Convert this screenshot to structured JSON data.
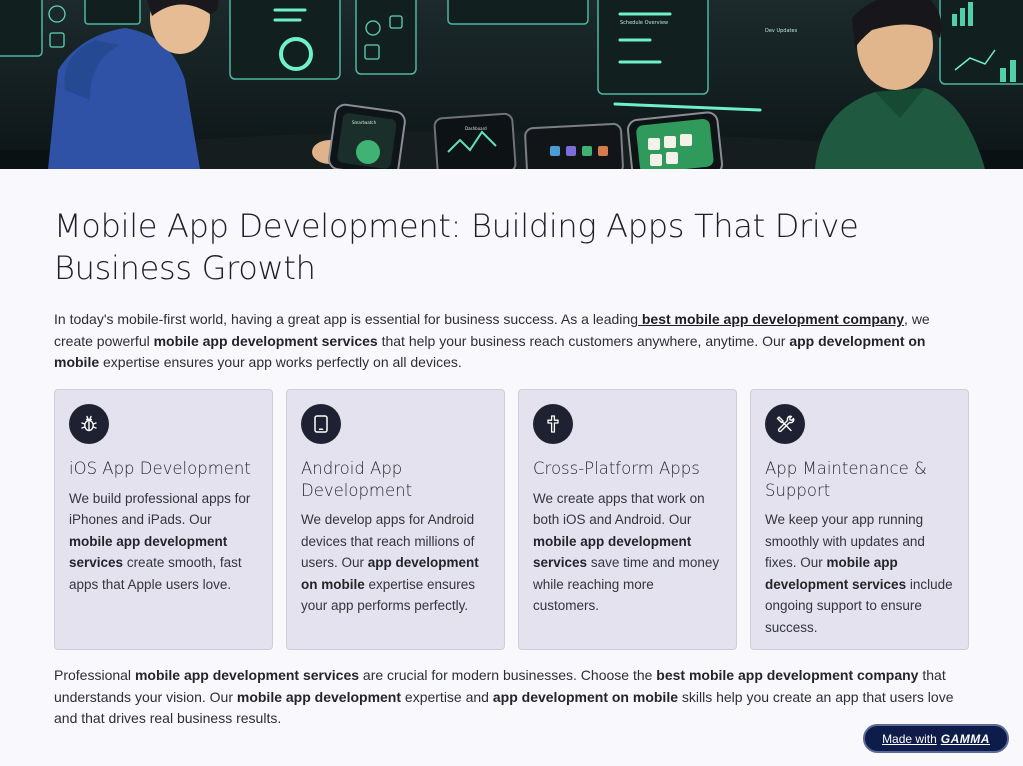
{
  "hero": {
    "image": "developers-with-mobile-devices-illustration",
    "screen_text": {
      "left_phone": "Smartwatch",
      "dashboard_label": "Dashboard",
      "panel_a": "Schedule Overview",
      "panel_b": "Dev Updates"
    }
  },
  "title": "Mobile App Development: Building Apps That Drive Business Growth",
  "intro": {
    "t1": "In today's mobile-first world, having a great app is essential for business success. As a leading",
    "link": " best mobile app development company",
    "t2": ", we create powerful ",
    "b1": "mobile app development services",
    "t3": " that help your business reach customers anywhere, anytime. Our ",
    "b2": "app development on mobile",
    "t4": " expertise ensures your app works perfectly on all devices."
  },
  "cards": [
    {
      "icon": "bug-icon",
      "title": "iOS App Development",
      "parts": [
        {
          "t": "We build professional apps for iPhones and iPads. Our "
        },
        {
          "b": "mobile app development services"
        },
        {
          "t": " create smooth, fast apps that Apple users love."
        }
      ]
    },
    {
      "icon": "tablet-icon",
      "title": "Android App Development",
      "parts": [
        {
          "t": "We develop apps for Android devices that reach millions of users. Our "
        },
        {
          "b": "app development on mobile"
        },
        {
          "t": " expertise ensures your app performs perfectly."
        }
      ]
    },
    {
      "icon": "cross-icon",
      "title": "Cross-Platform Apps",
      "parts": [
        {
          "t": "We create apps that work on both iOS and Android. Our "
        },
        {
          "b": "mobile app development services"
        },
        {
          "t": " save time and money while reaching more customers."
        }
      ]
    },
    {
      "icon": "tools-icon",
      "title": "App Maintenance & Support",
      "parts": [
        {
          "t": "We keep your app running smoothly with updates and fixes. Our "
        },
        {
          "b": "mobile app development services"
        },
        {
          "t": " include ongoing support to ensure success."
        }
      ]
    }
  ],
  "outro": {
    "t1": "Professional ",
    "b1": "mobile app development services",
    "t2": " are crucial for modern businesses. Choose the ",
    "b2": "best mobile app development company",
    "t3": " that understands your vision. Our ",
    "b3": "mobile app development",
    "t4": " expertise and ",
    "b4": "app development on mobile",
    "t5": " skills help you create an app that users love and that drives real business results."
  },
  "badge": {
    "prefix": "Made with",
    "brand": "GAMMA"
  },
  "colors": {
    "background": "#f9f8fd",
    "card": "#e3e2ee",
    "icon_circle": "#1f2132",
    "badge": "#0d1c4a"
  }
}
